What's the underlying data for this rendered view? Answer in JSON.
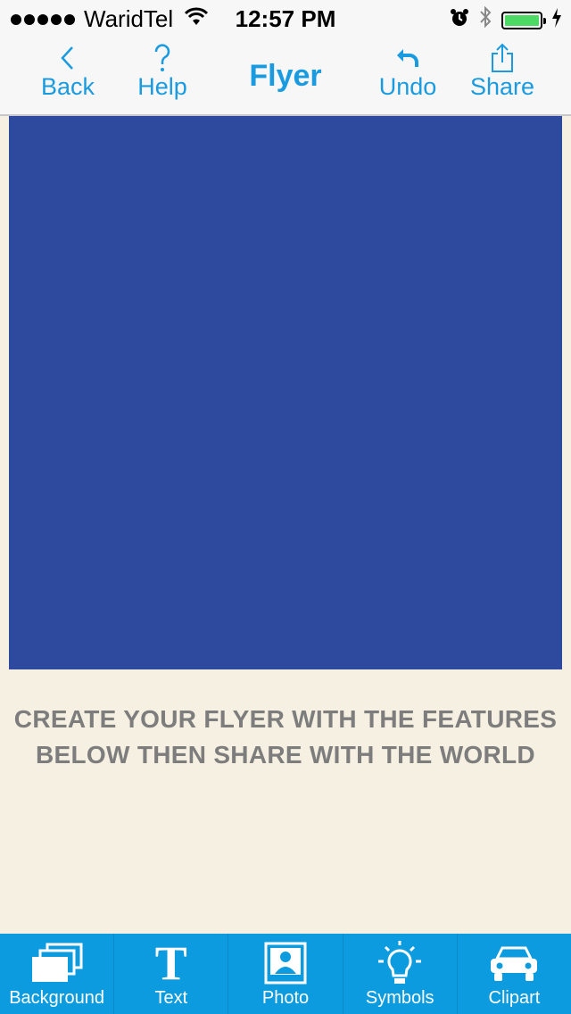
{
  "status_bar": {
    "carrier": "WaridTel",
    "time": "12:57 PM",
    "battery_level": 1.0
  },
  "nav": {
    "back_label": "Back",
    "help_label": "Help",
    "title": "Flyer",
    "undo_label": "Undo",
    "share_label": "Share"
  },
  "canvas": {
    "background_color": "#2d4a9e"
  },
  "promo": {
    "line1": "CREATE YOUR FLYER WITH THE FEATURES",
    "line2": "BELOW THEN SHARE WITH THE WORLD"
  },
  "toolbar": {
    "items": [
      {
        "label": "Background",
        "icon": "layers-icon"
      },
      {
        "label": "Text",
        "icon": "text-icon"
      },
      {
        "label": "Photo",
        "icon": "photo-icon"
      },
      {
        "label": "Symbols",
        "icon": "lightbulb-icon"
      },
      {
        "label": "Clipart",
        "icon": "car-icon"
      }
    ]
  },
  "colors": {
    "accent": "#1a9be0",
    "toolbar_bg": "#0c9bdf",
    "page_bg": "#f5f0e1",
    "promo_text": "#7d7d7d"
  }
}
